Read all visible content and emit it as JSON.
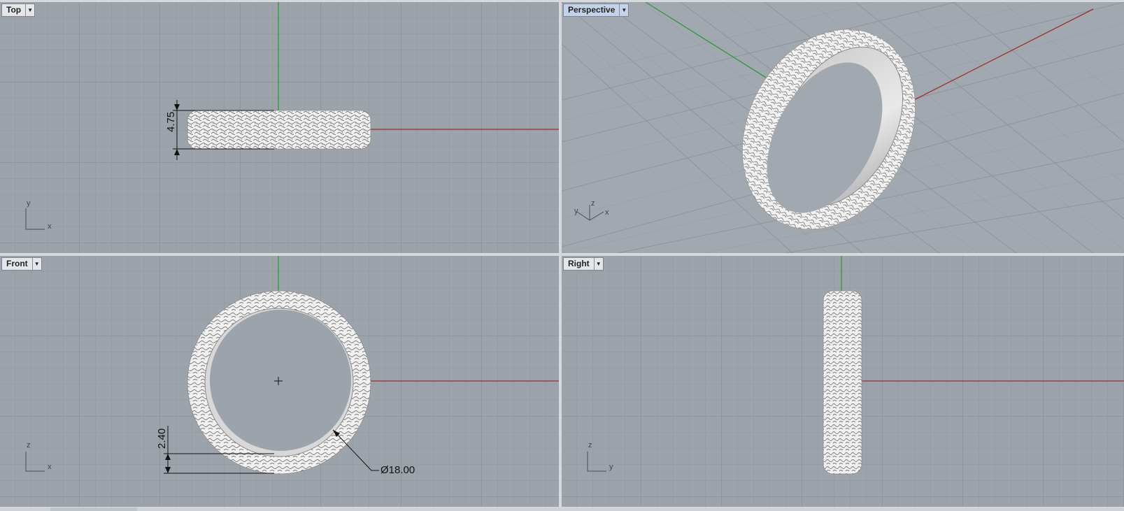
{
  "viewports": {
    "top": {
      "label": "Top"
    },
    "perspective": {
      "label": "Perspective"
    },
    "front": {
      "label": "Front"
    },
    "right": {
      "label": "Right"
    }
  },
  "dimensions": {
    "top_width": "4.75",
    "front_thickness": "2.40",
    "front_diameter": "Ø18.00"
  },
  "axes": {
    "top": {
      "v": "y",
      "h": "x"
    },
    "perspective": {
      "v": "z",
      "a": "y",
      "b": "x"
    },
    "front": {
      "v": "z",
      "h": "x"
    },
    "right": {
      "v": "z",
      "h": "y"
    }
  },
  "colors": {
    "x_axis": "#9b2f2f",
    "y_axis": "#2e9a3a",
    "active_tab": "#c5d3ea"
  }
}
